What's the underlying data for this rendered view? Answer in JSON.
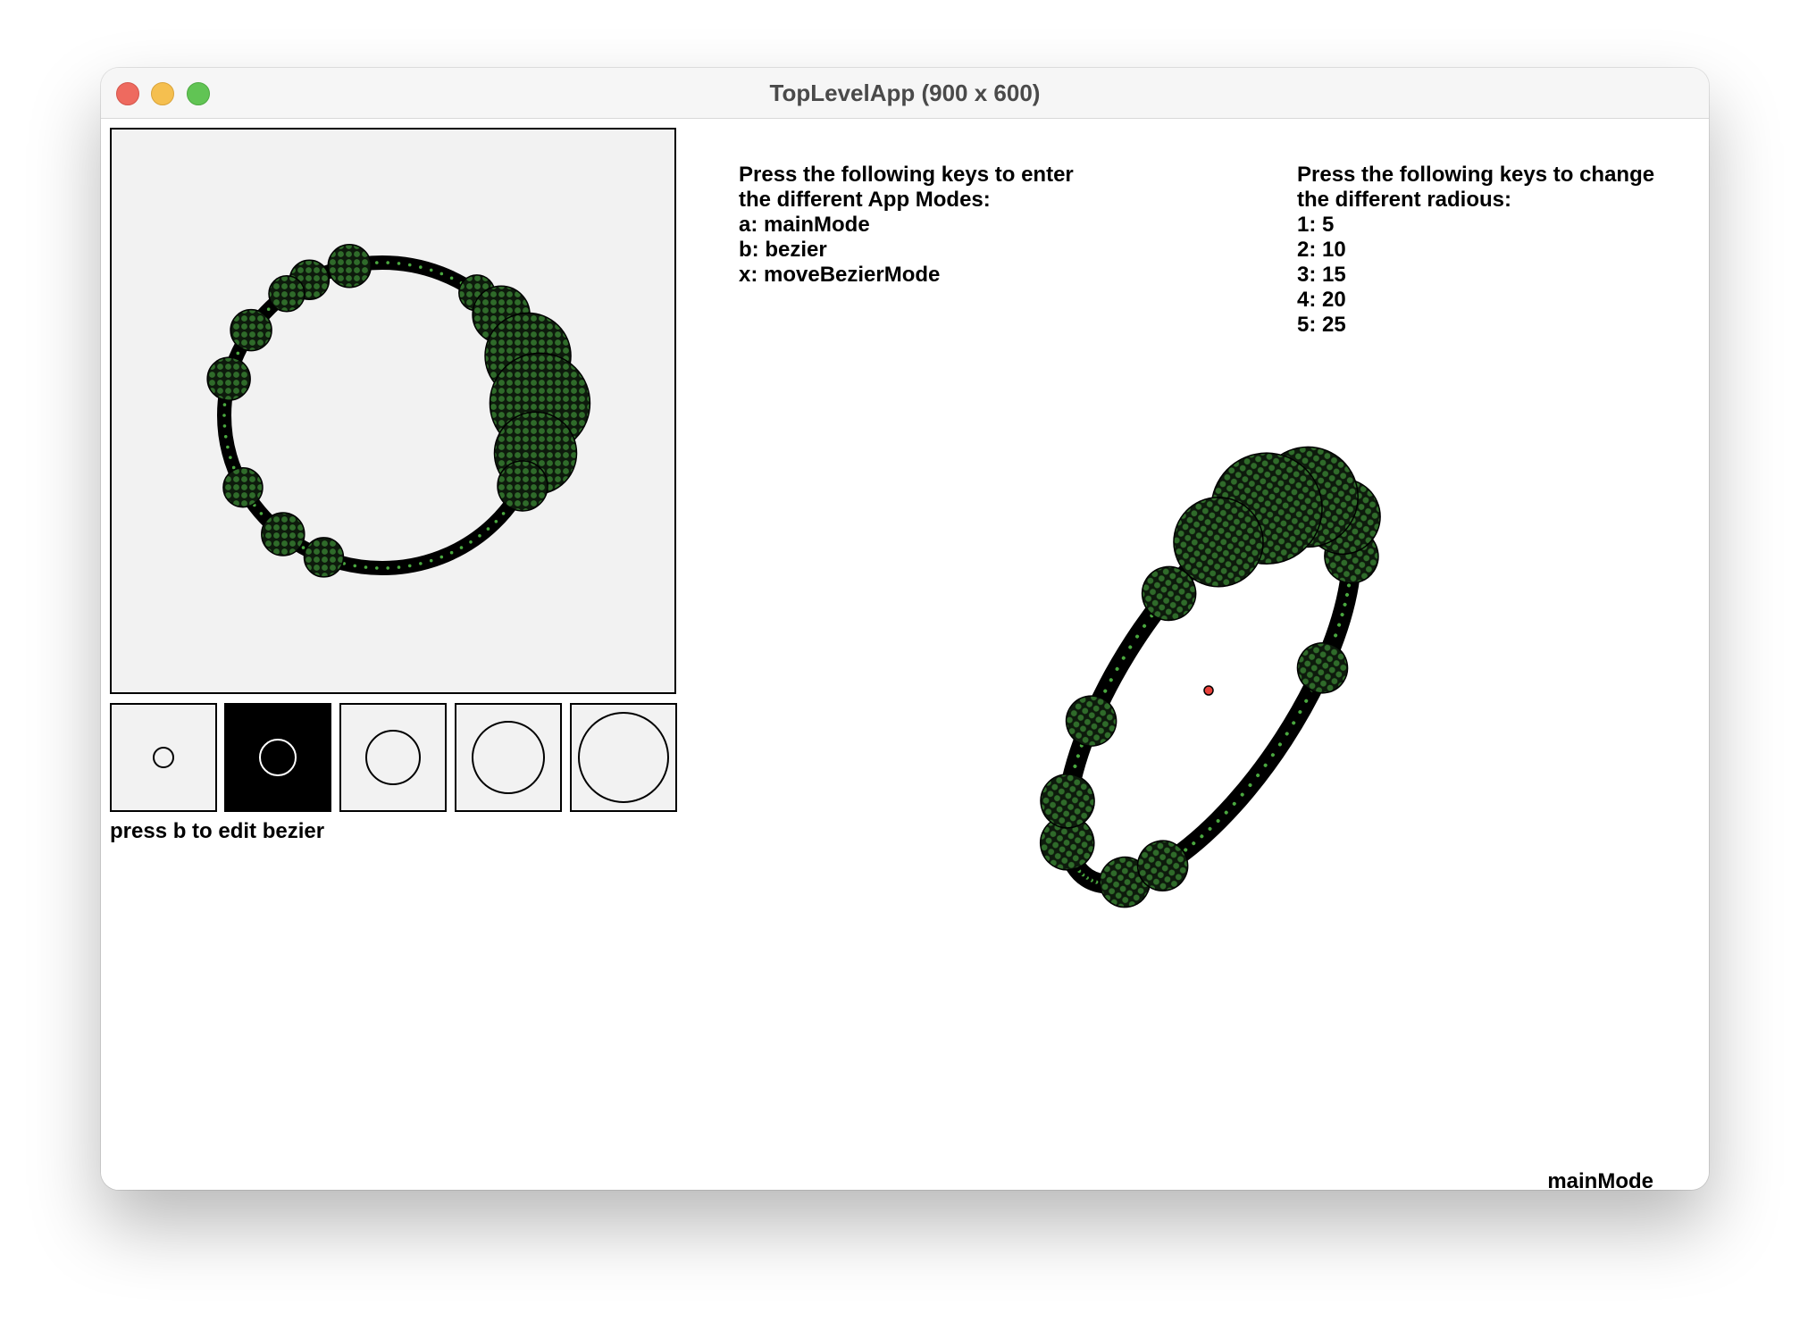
{
  "window": {
    "title": "TopLevelApp (900 x 600)"
  },
  "editor": {
    "hint": "press b to edit bezier"
  },
  "swatches": [
    {
      "radius_option": 5,
      "selected": false
    },
    {
      "radius_option": 10,
      "selected": true
    },
    {
      "radius_option": 15,
      "selected": false
    },
    {
      "radius_option": 20,
      "selected": false
    },
    {
      "radius_option": 25,
      "selected": false
    }
  ],
  "modes_help": {
    "lines": [
      "Press the following keys to enter",
      "the different App Modes:",
      "a: mainMode",
      "b: bezier",
      "x: moveBezierMode"
    ]
  },
  "radius_help": {
    "lines": [
      "Press the following keys to change",
      "the different radious:",
      "1: 5",
      "2: 10",
      "3: 15",
      "4: 20",
      "5: 25"
    ]
  },
  "status": {
    "mode": "mainMode"
  },
  "colors": {
    "bead_fill": "#2f6b2a",
    "bead_dot": "#4aa83f",
    "outline": "#000000",
    "center_marker": "#e8413a",
    "canvas_bg": "#f2f2f2"
  }
}
